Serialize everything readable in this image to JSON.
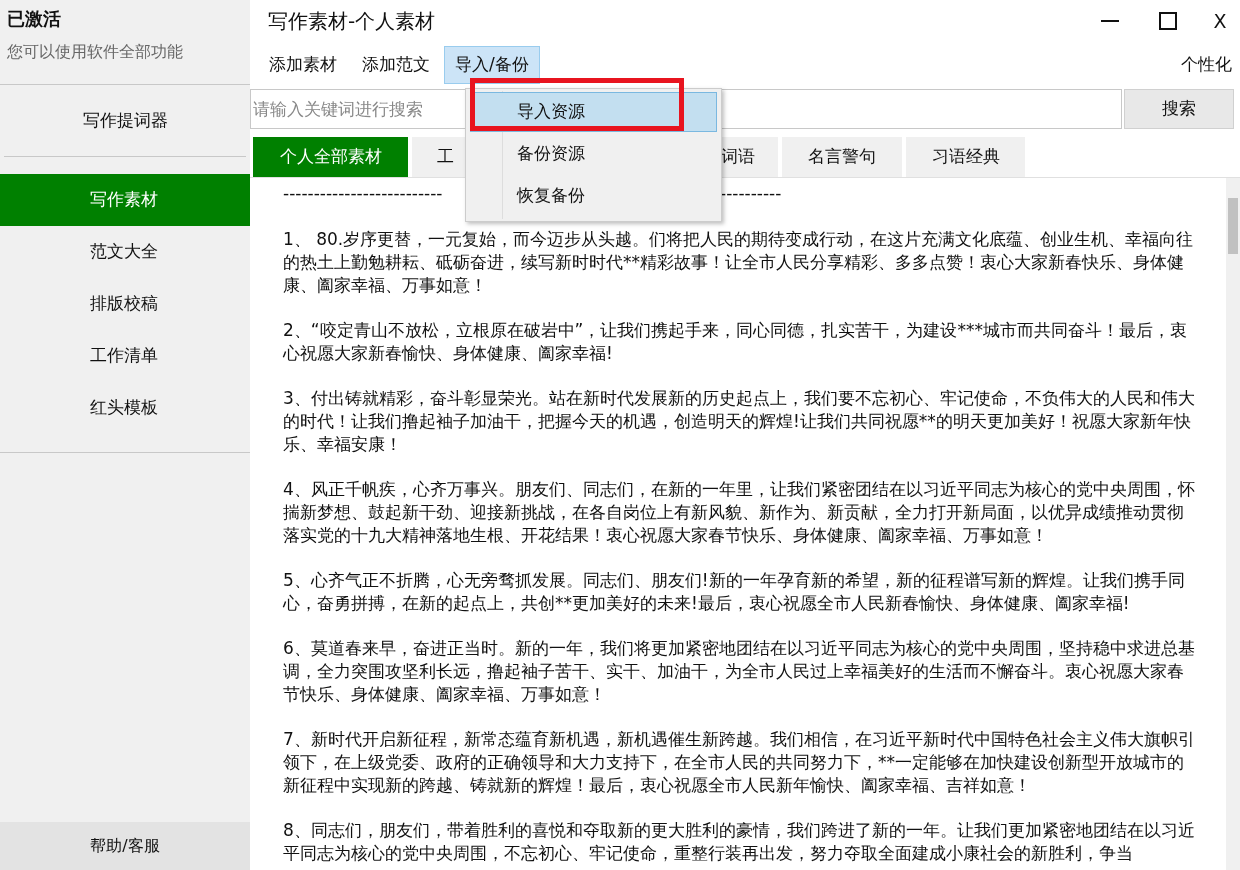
{
  "sidebar": {
    "status": "已激活",
    "status_note": "您可以使用软件全部功能",
    "tool_item": "写作提词器",
    "items": [
      {
        "label": "写作素材",
        "selected": true
      },
      {
        "label": "范文大全",
        "selected": false
      },
      {
        "label": "排版校稿",
        "selected": false
      },
      {
        "label": "工作清单",
        "selected": false
      },
      {
        "label": "红头模板",
        "selected": false
      }
    ],
    "help": "帮助/客服"
  },
  "window": {
    "title": "写作素材-个人素材",
    "close_label": "X"
  },
  "menu": {
    "items": [
      {
        "label": "添加素材",
        "open": false
      },
      {
        "label": "添加范文",
        "open": false
      },
      {
        "label": "导入/备份",
        "open": true
      }
    ],
    "right": "个性化"
  },
  "dropdown": {
    "items": [
      {
        "label": "导入资源",
        "selected": true,
        "framed": true
      },
      {
        "label": "备份资源",
        "selected": false,
        "framed": false
      },
      {
        "label": "恢复备份",
        "selected": false,
        "framed": false
      }
    ]
  },
  "search": {
    "placeholder": "请输入关键词进行搜索",
    "button": "搜索"
  },
  "tabs": [
    {
      "label": "个人全部素材",
      "selected": true
    },
    {
      "label": "工",
      "selected": false
    },
    {
      "label": "词语",
      "selected": false
    },
    {
      "label": "名言警句",
      "selected": false
    },
    {
      "label": "习语经典",
      "selected": false
    }
  ],
  "content": {
    "dashes": [
      "--------------------------",
      "----------"
    ],
    "paragraphs": [
      "1、 80.岁序更替，一元复始，而今迈步从头越。们将把人民的期待变成行动，在这片充满文化底蕴、创业生机、幸福向往的热土上勤勉耕耘、砥砺奋进，续写新时时代**精彩故事！让全市人民分享精彩、多多点赞！衷心大家新春快乐、身体健康、阖家幸福、万事如意！",
      "2、“咬定青山不放松，立根原在破岩中”，让我们携起手来，同心同德，扎实苦干，为建设***城市而共同奋斗！最后，衷心祝愿大家新春愉快、身体健康、阖家幸福!",
      "3、付出铸就精彩，奋斗彰显荣光。站在新时代发展新的历史起点上，我们要不忘初心、牢记使命，不负伟大的人民和伟大的时代！让我们撸起袖子加油干，把握今天的机遇，创造明天的辉煌!让我们共同祝愿**的明天更加美好！祝愿大家新年快乐、幸福安康！",
      "4、风正千帆疾，心齐万事兴。朋友们、同志们，在新的一年里，让我们紧密团结在以习近平同志为核心的党中央周围，怀揣新梦想、鼓起新干劲、迎接新挑战，在各自岗位上有新风貌、新作为、新贡献，全力打开新局面，以优异成绩推动贯彻落实党的十九大精神落地生根、开花结果！衷心祝愿大家春节快乐、身体健康、阖家幸福、万事如意！",
      "5、心齐气正不折腾，心无旁骛抓发展。同志们、朋友们!新的一年孕育新的希望，新的征程谱写新的辉煌。让我们携手同心，奋勇拼搏，在新的起点上，共创**更加美好的未来!最后，衷心祝愿全市人民新春愉快、身体健康、阖家幸福!",
      "6、莫道春来早，奋进正当时。新的一年，我们将更加紧密地团结在以习近平同志为核心的党中央周围，坚持稳中求进总基调，全力突围攻坚利长远，撸起袖子苦干、实干、加油干，为全市人民过上幸福美好的生活而不懈奋斗。衷心祝愿大家春节快乐、身体健康、阖家幸福、万事如意！",
      "7、新时代开启新征程，新常态蕴育新机遇，新机遇催生新跨越。我们相信，在习近平新时代中国特色社会主义伟大旗帜引领下，在上级党委、政府的正确领导和大力支持下，在全市人民的共同努力下，**一定能够在加快建设创新型开放城市的新征程中实现新的跨越、铸就新的辉煌！最后，衷心祝愿全市人民新年愉快、阖家幸福、吉祥如意！",
      "8、同志们，朋友们，带着胜利的喜悦和夺取新的更大胜利的豪情，我们跨进了新的一年。让我们更加紧密地团结在以习近平同志为核心的党中央周围，不忘初心、牢记使命，重整行装再出发，努力夺取全面建成小康社会的新胜利，争当"
    ]
  }
}
